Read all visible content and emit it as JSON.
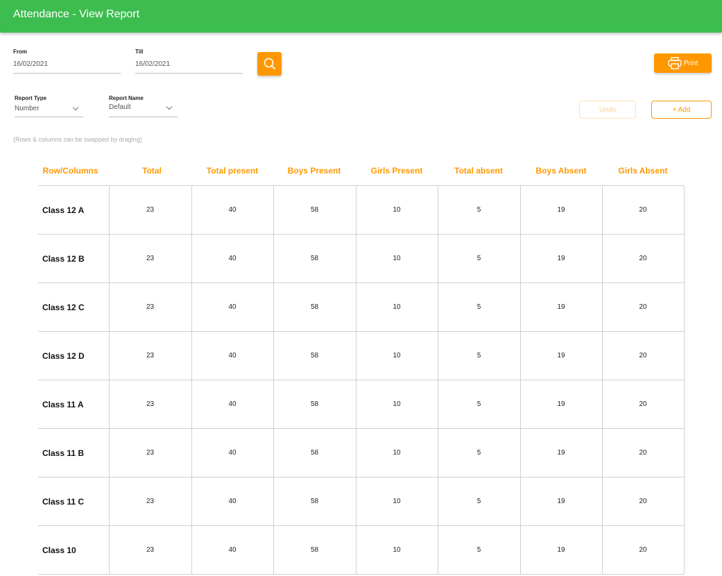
{
  "appbar": {
    "title": "Attendance - View Report"
  },
  "filters": {
    "from_label": "From",
    "from_value": "16/02/2021",
    "till_label": "Till",
    "till_value": "16/02/2021",
    "report_type_label": "Report Type",
    "report_type_value": "Number",
    "report_name_label": "Report Name",
    "report_name_value": "Default"
  },
  "toolbar": {
    "search_icon": "search-icon",
    "print_label": "Print",
    "print_icon": "printer-icon",
    "undo_label": "Undo",
    "add_label": "+ Add"
  },
  "hint": "(Rows & columns can be swapped by draging)",
  "colors": {
    "appbar": "#3dbd4f",
    "accent": "#ff9800"
  },
  "table": {
    "columns": [
      "Row/Columns",
      "Total",
      "Total present",
      "Boys Present",
      "Girls Present",
      "Total absent",
      "Boys Absent",
      "Girls Absent"
    ],
    "rows": [
      [
        "Class 12 A",
        "23",
        "40",
        "58",
        "10",
        "5",
        "19",
        "20"
      ],
      [
        "Class 12 B",
        "23",
        "40",
        "58",
        "10",
        "5",
        "19",
        "20"
      ],
      [
        "Class 12 C",
        "23",
        "40",
        "58",
        "10",
        "5",
        "19",
        "20"
      ],
      [
        "Class 12 D",
        "23",
        "40",
        "58",
        "10",
        "5",
        "19",
        "20"
      ],
      [
        "Class 11 A",
        "23",
        "40",
        "58",
        "10",
        "5",
        "19",
        "20"
      ],
      [
        "Class 11 B",
        "23",
        "40",
        "58",
        "10",
        "5",
        "19",
        "20"
      ],
      [
        "Class 11 C",
        "23",
        "40",
        "58",
        "10",
        "5",
        "19",
        "20"
      ],
      [
        "Class 10",
        "23",
        "40",
        "58",
        "10",
        "5",
        "19",
        "20"
      ]
    ]
  }
}
